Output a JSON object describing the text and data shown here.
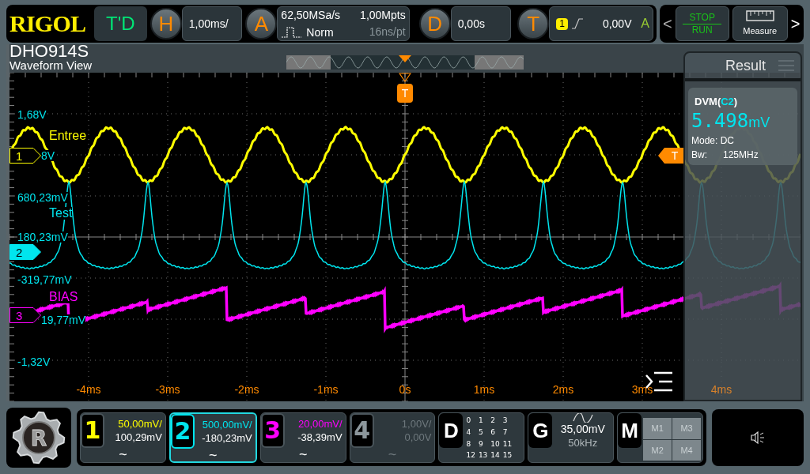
{
  "brand": {
    "logo": "RIGOL",
    "model": "DHO914S"
  },
  "top_bar": {
    "mode": "T'D",
    "horizontal": {
      "key": "H",
      "scale": "1,00ms/"
    },
    "acquire": {
      "key": "A",
      "sample_rate": "62,50MSa/s",
      "mode": "Norm",
      "memory_depth": "1,00Mpts",
      "resolution": "16ns/pt"
    },
    "delay": {
      "key": "D",
      "value": "0,00s"
    },
    "trigger": {
      "key": "T",
      "source": "1",
      "level": "0,00V",
      "sweep": "A"
    }
  },
  "controls": {
    "prev": "<",
    "run_stop": {
      "stop": "STOP",
      "run": "RUN"
    },
    "measure": "Measure",
    "next": ">"
  },
  "waveform_view": {
    "title": "Waveform View",
    "trigger_marker": "T",
    "trigger_level_marker": "T",
    "y_labels": [
      "1,68V",
      "8V",
      "680,23mV",
      "180,23mV",
      "-319,77mV",
      "19,77mV",
      "-1,32V"
    ],
    "x_labels": [
      "-4ms",
      "-3ms",
      "-2ms",
      "-1ms",
      "0s",
      "1ms",
      "2ms",
      "3ms",
      "4ms"
    ],
    "traces": [
      {
        "label": "Entree",
        "marker": "1",
        "color": "#ffff00"
      },
      {
        "label": "Test",
        "marker": "2",
        "color": "#00e5ee"
      },
      {
        "label": "BIAS",
        "marker": "3",
        "color": "#ff00ff"
      }
    ]
  },
  "result_panel": {
    "title": "Result",
    "dvm_prefix": "DVM(",
    "dvm_source": "C2",
    "dvm_suffix": ")",
    "reading": "5.498",
    "unit": "mV",
    "mode": "Mode: DC",
    "bandwidth_label": "Bw:",
    "bandwidth": "125MHz"
  },
  "channels": [
    {
      "number": "1",
      "scale": "50,00mV/",
      "offset": "100,29mV",
      "coupling": "~",
      "color": "#ffff00",
      "selected": false,
      "enabled": true
    },
    {
      "number": "2",
      "scale": "500,00mV/",
      "offset": "-180,23mV",
      "coupling": "~",
      "color": "#00e5ee",
      "selected": true,
      "enabled": true
    },
    {
      "number": "3",
      "scale": "20,00mV/",
      "offset": "-38,39mV",
      "coupling": "~",
      "color": "#ff00ff",
      "selected": false,
      "enabled": true
    },
    {
      "number": "4",
      "scale": "1,00V/",
      "offset": "0,00V",
      "coupling": "~",
      "color": "#8c969b",
      "selected": false,
      "enabled": false
    }
  ],
  "digital": {
    "key": "D",
    "bits": [
      "0",
      "1",
      "2",
      "3",
      "4",
      "5",
      "6",
      "7",
      "8",
      "9",
      "10",
      "11",
      "12",
      "13",
      "14",
      "15"
    ]
  },
  "generator": {
    "key": "G",
    "amplitude": "35,00mV",
    "frequency": "50kHz"
  },
  "math": {
    "key": "M",
    "slots": [
      "M1",
      "M3",
      "M2",
      "M4"
    ]
  },
  "logo_letter": "R"
}
